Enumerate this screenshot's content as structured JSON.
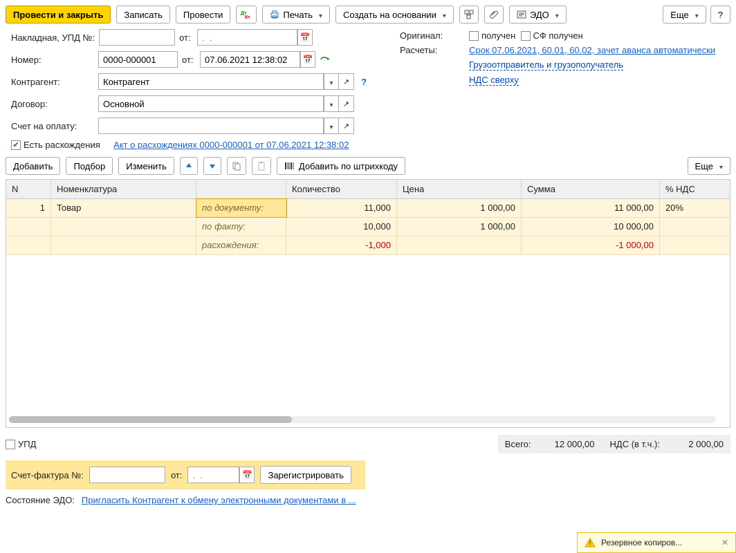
{
  "toolbar": {
    "post_and_close": "Провести и закрыть",
    "write": "Записать",
    "post": "Провести",
    "print": "Печать",
    "create_based": "Создать на основании",
    "edo": "ЭДО",
    "more": "Еще",
    "help": "?"
  },
  "header": {
    "invoice_label": "Накладная, УПД №:",
    "from": "от:",
    "date_placeholder": ".  .",
    "original_label": "Оригинал:",
    "received": "получен",
    "sf_received": "СФ получен",
    "number_label": "Номер:",
    "number_value": "0000-000001",
    "doc_date": "07.06.2021 12:38:02",
    "settlements_label": "Расчеты:",
    "settlements_link": "Срок 07.06.2021, 60.01, 60.02, зачет аванса автоматически",
    "counterparty_label": "Контрагент:",
    "counterparty_value": "Контрагент",
    "consignor_link": "Грузоотправитель и грузополучатель",
    "contract_label": "Договор:",
    "contract_value": "Основной",
    "vat_link": "НДС сверху",
    "invoice_for_payment_label": "Счет на оплату:",
    "has_discrep": "Есть расхождения",
    "discrep_link": "Акт о расхождениях 0000-000001 от 07.06.2021 12:38:02"
  },
  "table_toolbar": {
    "add": "Добавить",
    "pick": "Подбор",
    "edit": "Изменить",
    "add_by_barcode": "Добавить по штрихкоду",
    "more": "Еще"
  },
  "grid": {
    "cols": {
      "n": "N",
      "nom": "Номенклатура",
      "qty": "Количество",
      "price": "Цена",
      "sum": "Сумма",
      "vat": "% НДС"
    },
    "row": {
      "n": "1",
      "nom": "Товар",
      "vat": "20%",
      "sub": {
        "by_doc": "по документу:",
        "by_fact": "по факту:",
        "diff": "расхождения:"
      },
      "vals": {
        "by_doc": {
          "qty": "11,000",
          "price": "1 000,00",
          "sum": "11 000,00"
        },
        "by_fact": {
          "qty": "10,000",
          "price": "1 000,00",
          "sum": "10 000,00"
        },
        "diff": {
          "qty": "-1,000",
          "price": "",
          "sum": "-1 000,00"
        }
      }
    }
  },
  "footer": {
    "upd": "УПД",
    "total_label": "Всего:",
    "total_value": "12 000,00",
    "vat_label": "НДС (в т.ч.):",
    "vat_value": "2 000,00"
  },
  "sf": {
    "label": "Счет-фактура №:",
    "from": "от:",
    "date_ph": ".  .",
    "register": "Зарегистрировать"
  },
  "edo": {
    "label": "Состояние ЭДО:",
    "link": "Пригласить Контрагент к обмену электронными документами в ..."
  },
  "notif": {
    "text": "Резервное копиров..."
  }
}
